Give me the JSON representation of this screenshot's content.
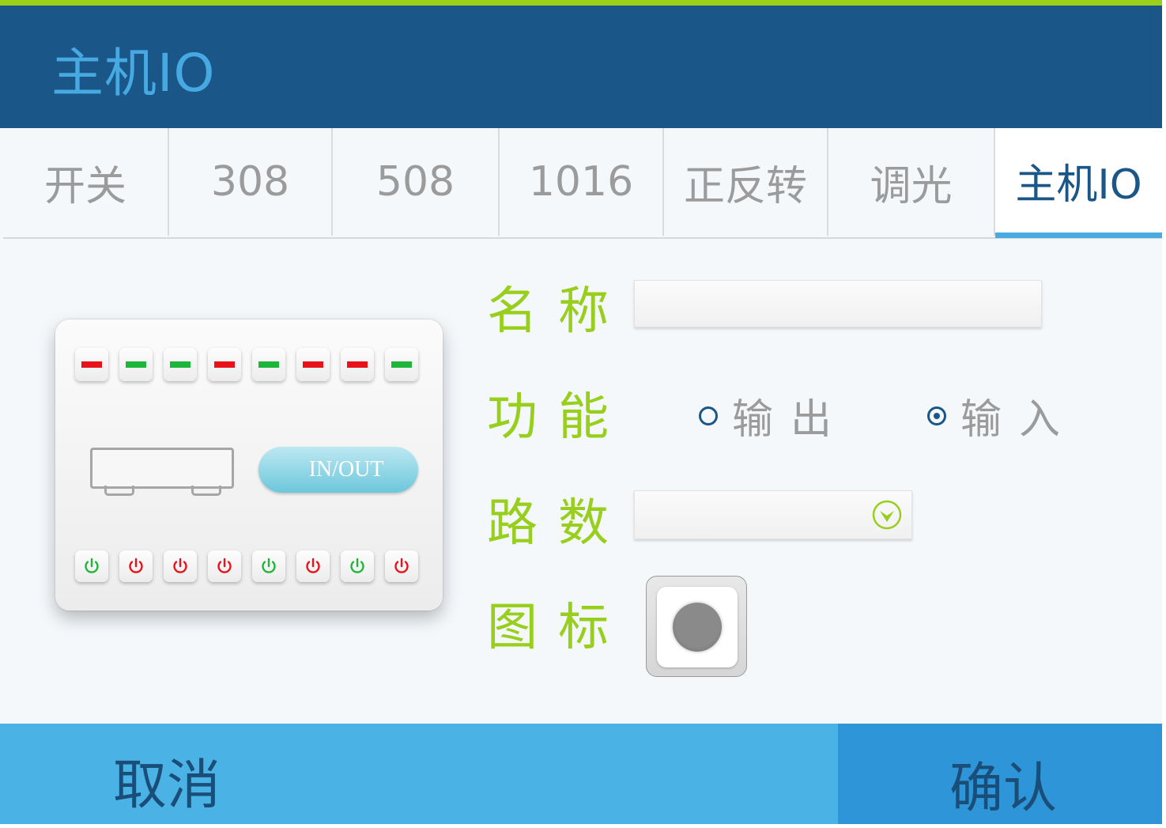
{
  "header": {
    "title": "主机IO"
  },
  "tabs": [
    {
      "label": "开关"
    },
    {
      "label": "308"
    },
    {
      "label": "508"
    },
    {
      "label": "1016"
    },
    {
      "label": "正反转"
    },
    {
      "label": "调光"
    },
    {
      "label": "主机IO",
      "active": true
    }
  ],
  "device": {
    "button_label": "IN/OUT",
    "led_states": [
      "red",
      "green",
      "green",
      "red",
      "green",
      "red",
      "red",
      "green"
    ],
    "power_states": [
      "green",
      "red",
      "red",
      "red",
      "green",
      "red",
      "green",
      "red"
    ]
  },
  "form": {
    "name_label": "名称",
    "name_value": "",
    "function_label": "功能",
    "function_options": [
      {
        "label": "输出",
        "selected": false
      },
      {
        "label": "输入",
        "selected": true
      }
    ],
    "channels_label": "路数",
    "channels_value": "",
    "icon_label": "图标"
  },
  "footer": {
    "cancel_label": "取消",
    "confirm_label": "确认"
  },
  "colors": {
    "header_bg": "#1a5688",
    "accent_green": "#97cf1c",
    "accent_blue": "#4aabe0",
    "led_red": "#e8121a",
    "led_green": "#1db63a"
  }
}
